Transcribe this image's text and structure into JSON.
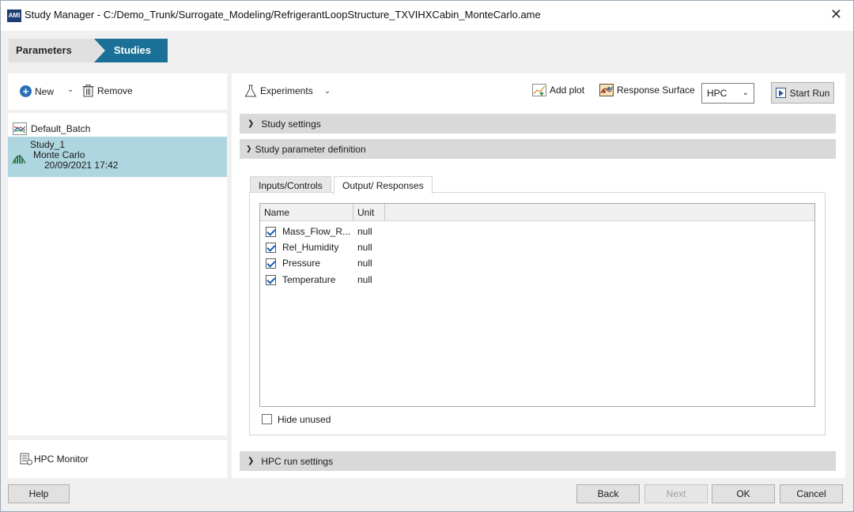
{
  "window": {
    "title": "Study Manager - C:/Demo_Trunk/Surrogate_Modeling/RefrigerantLoopStructure_TXVIHXCabin_MonteCarlo.ame",
    "logo_text": "AMI",
    "close_glyph": "✕"
  },
  "breadcrumb": {
    "parameters": "Parameters",
    "studies": "Studies",
    "active": "Studies",
    "active_color": "#1b7097"
  },
  "left_toolbar": {
    "new_label": "New",
    "remove_label": "Remove"
  },
  "studies_list": [
    {
      "name": "Default_Batch",
      "icon": "chart-icon"
    },
    {
      "name": "Study_1",
      "type": "Monte Carlo",
      "date": "20/09/2021 17:42",
      "icon": "monte-carlo-icon",
      "selected": true
    }
  ],
  "hpc_monitor": {
    "label": "HPC Monitor"
  },
  "right_toolbar": {
    "experiments_label": "Experiments",
    "add_plot_label": "Add plot",
    "response_surface_label": "Response Surface",
    "hpc_select": "HPC",
    "start_run_label": "Start Run"
  },
  "sections": {
    "study_settings": "Study settings",
    "study_parameter_definition": "Study parameter definition",
    "hpc_run_settings": "HPC run settings"
  },
  "tabs": [
    {
      "label": "Inputs/Controls",
      "active": false
    },
    {
      "label": "Output/ Responses",
      "active": true
    }
  ],
  "table": {
    "columns": [
      "Name",
      "Unit"
    ],
    "rows": [
      {
        "name": "Mass_Flow_R...",
        "unit": "null",
        "checked": true
      },
      {
        "name": "Rel_Humidity",
        "unit": "null",
        "checked": true
      },
      {
        "name": "Pressure",
        "unit": "null",
        "checked": true
      },
      {
        "name": "Temperature",
        "unit": "null",
        "checked": true
      }
    ]
  },
  "hide_unused": {
    "label": "Hide unused",
    "checked": false
  },
  "footer": {
    "help": "Help",
    "back": "Back",
    "next": "Next",
    "ok": "OK",
    "cancel": "Cancel"
  }
}
